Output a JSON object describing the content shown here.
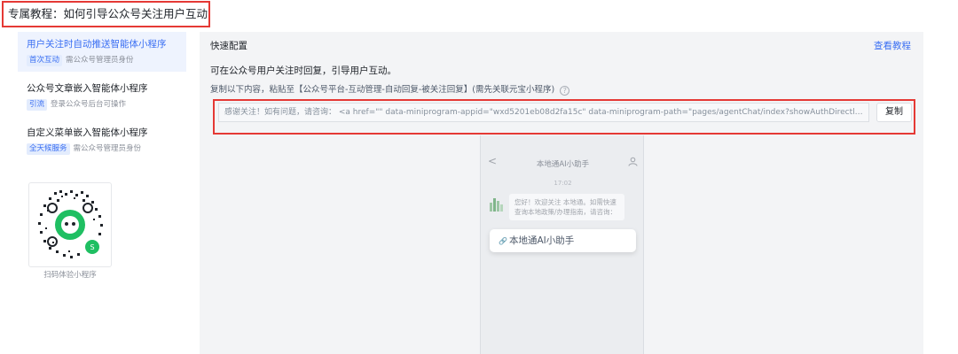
{
  "page": {
    "title": "专属教程：如何引导公众号关注用户互动?"
  },
  "sidebar": {
    "items": [
      {
        "title": "用户关注时自动推送智能体小程序",
        "tag": "首次互动",
        "note": "需公众号管理员身份",
        "active": true
      },
      {
        "title": "公众号文章嵌入智能体小程序",
        "tag": "引流",
        "note": "登录公众号后台可操作",
        "active": false
      },
      {
        "title": "自定义菜单嵌入智能体小程序",
        "tag": "全天候服务",
        "note": "需公众号管理员身份",
        "active": false
      }
    ],
    "qr_caption": "扫码体验小程序"
  },
  "main": {
    "header": "快速配置",
    "tutorial_link": "查看教程",
    "desc1": "可在公众号用户关注时回复，引导用户互动。",
    "desc2": "复制以下内容，粘贴至【公众号平台-互动管理-自动回复-被关注回复】(需先关联元宝小程序)",
    "help_icon": "?",
    "code_text": "感谢关注！如有问题，请咨询： <a href=\"\" data-miniprogram-appid=\"wxd5201eb08d2fa15c\" data-miniprogram-path=\"pages/agentChat/index?showAuthDirectly=1&age...",
    "copy_label": "复制"
  },
  "preview": {
    "back": "<",
    "title": "本地通AI小助手",
    "time": "17:02",
    "bubble": "您好！欢迎关注 本地通。如需快速查询本地政策/办理指南，请咨询：",
    "card_link_icon": "🔗",
    "card_label": "本地通AI小助手"
  },
  "colors": {
    "accent": "#3a6ff3",
    "highlight_border": "#e53935",
    "panel_bg": "#f3f4f6"
  }
}
